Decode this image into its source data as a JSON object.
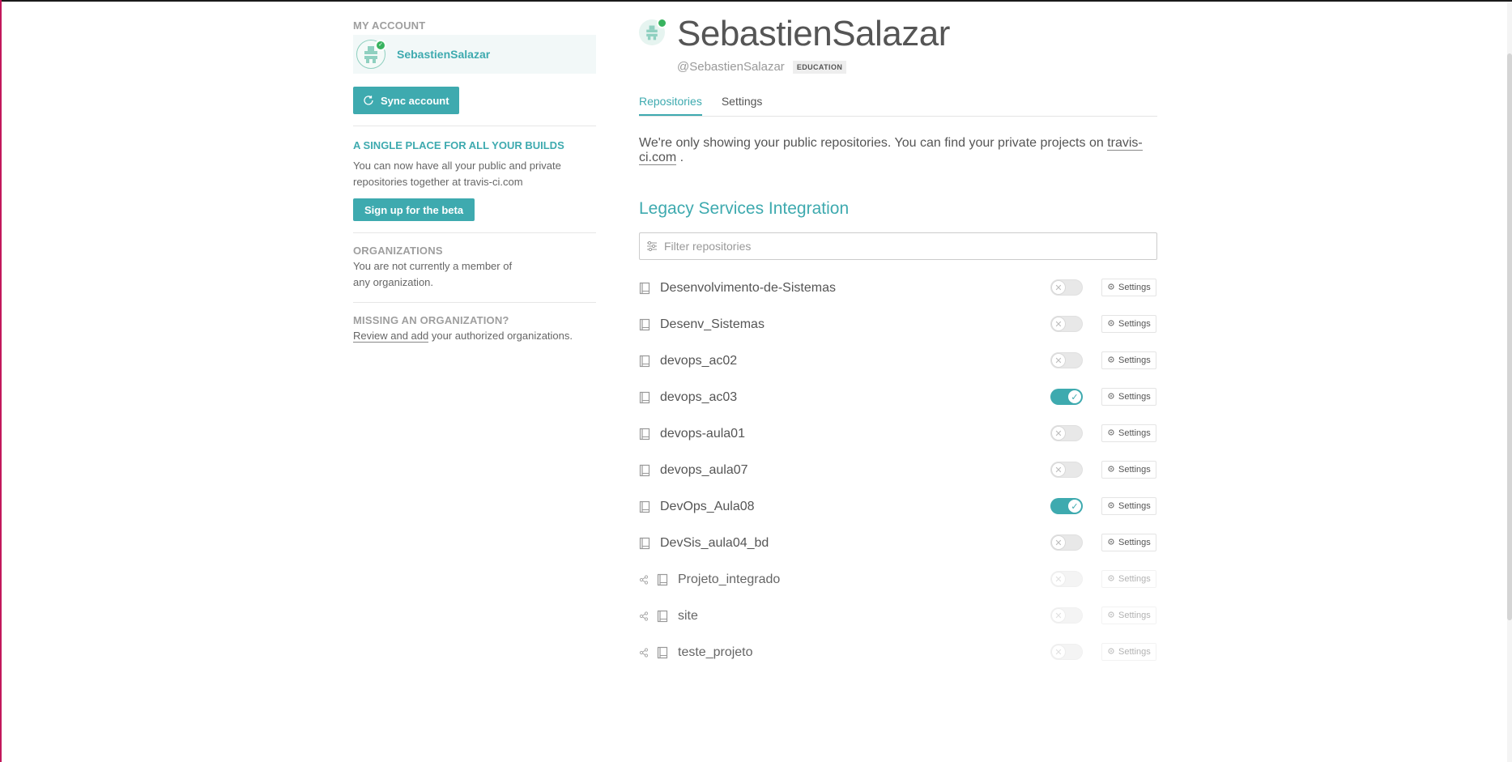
{
  "sidebar": {
    "my_account_heading": "MY ACCOUNT",
    "account_name": "SebastienSalazar",
    "sync_button": "Sync account",
    "promo_title": "A SINGLE PLACE FOR ALL YOUR BUILDS",
    "promo_text": "You can now have all your public and private repositories together at travis-ci.com",
    "beta_button": "Sign up for the beta",
    "orgs_heading": "ORGANIZATIONS",
    "orgs_text_1": "You are not currently a member of",
    "orgs_text_2": "any organization.",
    "missing_heading": "MISSING AN ORGANIZATION?",
    "missing_link": "Review and add",
    "missing_text": " your authorized organizations."
  },
  "profile": {
    "name": "SebastienSalazar",
    "handle": "@SebastienSalazar",
    "badge": "EDUCATION"
  },
  "tabs": [
    {
      "label": "Repositories",
      "active": true
    },
    {
      "label": "Settings",
      "active": false
    }
  ],
  "notice": {
    "text": "We're only showing your public repositories. You can find your private projects on ",
    "link": "travis-ci.com",
    "suffix": " ."
  },
  "section_title": "Legacy Services Integration",
  "filter": {
    "placeholder": "Filter repositories"
  },
  "settings_label": "Settings",
  "repos": [
    {
      "name": "Desenvolvimento-de-Sistemas",
      "enabled": false,
      "fork": false
    },
    {
      "name": "Desenv_Sistemas",
      "enabled": false,
      "fork": false
    },
    {
      "name": "devops_ac02",
      "enabled": false,
      "fork": false
    },
    {
      "name": "devops_ac03",
      "enabled": true,
      "fork": false
    },
    {
      "name": "devops-aula01",
      "enabled": false,
      "fork": false
    },
    {
      "name": "devops_aula07",
      "enabled": false,
      "fork": false
    },
    {
      "name": "DevOps_Aula08",
      "enabled": true,
      "fork": false
    },
    {
      "name": "DevSis_aula04_bd",
      "enabled": false,
      "fork": false
    },
    {
      "name": "Projeto_integrado",
      "enabled": false,
      "fork": true
    },
    {
      "name": "site",
      "enabled": false,
      "fork": true
    },
    {
      "name": "teste_projeto",
      "enabled": false,
      "fork": true
    }
  ],
  "colors": {
    "accent": "#3eaaaf",
    "badge_green": "#38b35f"
  }
}
